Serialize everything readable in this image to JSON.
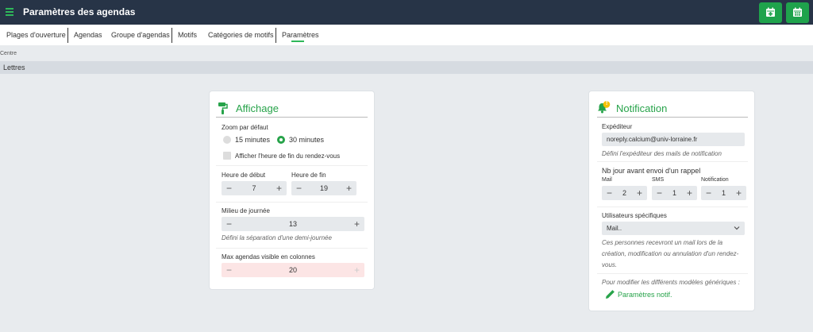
{
  "header": {
    "title": "Paramètres des agendas",
    "menu_icon": "hamburger-icon",
    "buttons": [
      {
        "icon": "calendar-plus-icon"
      },
      {
        "icon": "calendar-grid-icon"
      }
    ]
  },
  "tabs": [
    {
      "label": "Plages d'ouverture"
    },
    {
      "label": "Agendas"
    },
    {
      "label": "Groupe d'agendas"
    },
    {
      "label": "Motifs"
    },
    {
      "label": "Catégories de motifs"
    },
    {
      "label": "Paramètres",
      "active": true
    }
  ],
  "breadcrumb": "Centre",
  "section_bar": "Lettres",
  "colors": {
    "accent": "#27a34a",
    "topbar": "#273447",
    "warning_bg": "#fce5e5"
  },
  "affichage": {
    "title": "Affichage",
    "icon": "paint-roller-icon",
    "zoom_label": "Zoom par défaut",
    "zoom_options": [
      {
        "label": "15 minutes",
        "selected": false
      },
      {
        "label": "30 minutes",
        "selected": true
      }
    ],
    "show_end_label": "Afficher l'heure de fin du rendez-vous",
    "show_end_checked": false,
    "start_label": "Heure de début",
    "start_value": "7",
    "end_label": "Heure de fin",
    "end_value": "19",
    "midday_label": "Milieu de journée",
    "midday_value": "13",
    "midday_help": "Défini la séparation d'une demi-journée",
    "max_label": "Max agendas visible en colonnes",
    "max_value": "20"
  },
  "notification": {
    "title": "Notification",
    "icon": "bell-icon",
    "badge": "!",
    "sender_label": "Expéditeur",
    "sender_value": "noreply.calcium@univ-lorraine.fr",
    "sender_help": "Défini l'expéditeur des mails de notification",
    "reminder_label": "Nb jour avant envoi d'un rappel",
    "mail_label": "Mail",
    "mail_value": "2",
    "sms_label": "SMS",
    "sms_value": "1",
    "notif_label": "Notification",
    "notif_value": "1",
    "users_label": "Utilisateurs spécifiques",
    "users_selected": "Mail..",
    "users_help_1": "Ces personnes recevront un mail lors de la",
    "users_help_2": "création, modification ou annulation d'un rendez-",
    "users_help_3": "vous.",
    "modify_help": "Pour modifier les différents modèles génériques :",
    "link_label": "Paramètres notif.",
    "link_icon": "pencil-icon"
  }
}
